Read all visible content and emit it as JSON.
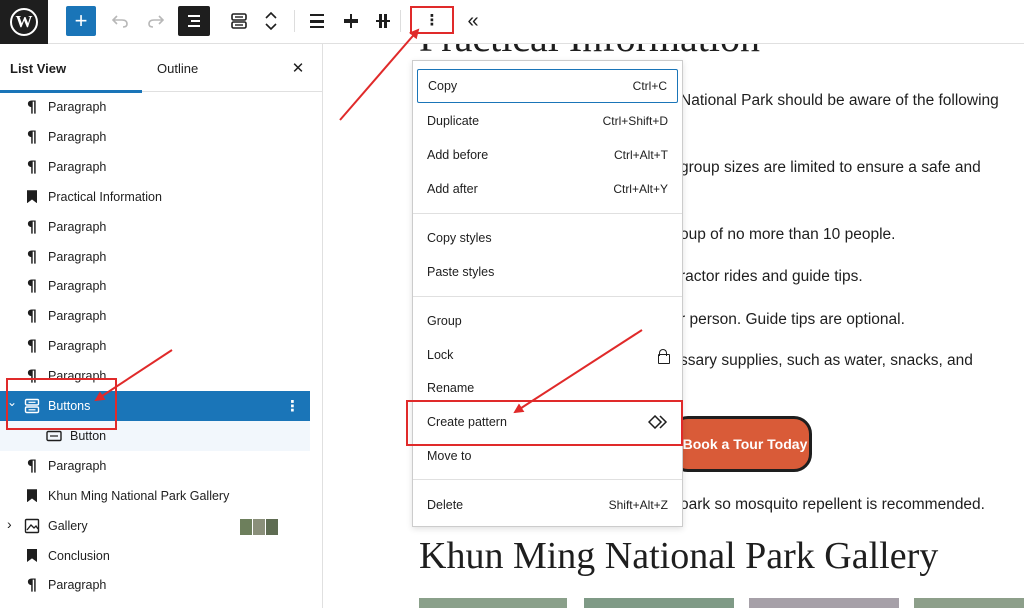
{
  "toolbar": {
    "logo_glyph": "W",
    "add_glyph": "+",
    "collapse_glyph": "«",
    "options_glyph": "⋮"
  },
  "sidebar": {
    "tabs": [
      {
        "label": "List View"
      },
      {
        "label": "Outline"
      }
    ],
    "close_glyph": "✕",
    "items": [
      {
        "label": "Paragraph",
        "icon": "paragraph-icon"
      },
      {
        "label": "Paragraph",
        "icon": "paragraph-icon"
      },
      {
        "label": "Paragraph",
        "icon": "paragraph-icon"
      },
      {
        "label": "Practical Information",
        "icon": "heading-bookmark-icon"
      },
      {
        "label": "Paragraph",
        "icon": "paragraph-icon"
      },
      {
        "label": "Paragraph",
        "icon": "paragraph-icon"
      },
      {
        "label": "Paragraph",
        "icon": "paragraph-icon"
      },
      {
        "label": "Paragraph",
        "icon": "paragraph-icon"
      },
      {
        "label": "Paragraph",
        "icon": "paragraph-icon"
      },
      {
        "label": "Paragraph",
        "icon": "paragraph-icon"
      },
      {
        "label": "Buttons",
        "icon": "buttons-icon",
        "selected": true
      },
      {
        "label": "Button",
        "icon": "button-icon",
        "child": true
      },
      {
        "label": "Paragraph",
        "icon": "paragraph-icon"
      },
      {
        "label": "Khun Ming National Park Gallery",
        "icon": "heading-bookmark-icon"
      },
      {
        "label": "Gallery",
        "icon": "gallery-icon"
      },
      {
        "label": "Conclusion",
        "icon": "heading-bookmark-icon"
      },
      {
        "label": "Paragraph",
        "icon": "paragraph-icon"
      }
    ]
  },
  "canvas": {
    "heading_top": "Practical Information",
    "lines": [
      "National Park should be aware of the following",
      "group sizes are limited to ensure a safe and",
      "oup of no more than 10 people.",
      "ractor rides and guide tips.",
      "r person. Guide tips are optional.",
      "ssary supplies, such as water, snacks, and",
      "oark so mosquito repellent is recommended."
    ],
    "tour_button": "Book a Tour Today",
    "gallery_heading": "Khun Ming National Park Gallery"
  },
  "menu": {
    "groups": [
      [
        {
          "label": "Copy",
          "shortcut": "Ctrl+C"
        },
        {
          "label": "Duplicate",
          "shortcut": "Ctrl+Shift+D"
        },
        {
          "label": "Add before",
          "shortcut": "Ctrl+Alt+T"
        },
        {
          "label": "Add after",
          "shortcut": "Ctrl+Alt+Y"
        }
      ],
      [
        {
          "label": "Copy styles",
          "shortcut": ""
        },
        {
          "label": "Paste styles",
          "shortcut": ""
        }
      ],
      [
        {
          "label": "Group",
          "shortcut": ""
        },
        {
          "label": "Lock",
          "shortcut": ""
        },
        {
          "label": "Rename",
          "shortcut": ""
        },
        {
          "label": "Create pattern",
          "shortcut": ""
        },
        {
          "label": "Move to",
          "shortcut": ""
        }
      ],
      [
        {
          "label": "Delete",
          "shortcut": "Shift+Alt+Z"
        }
      ]
    ]
  },
  "colors": {
    "accent": "#1a75b8",
    "annotation_red": "#e02a2a",
    "tour_button_bg": "#d95b38",
    "toolbar_dark": "#1e1e1e"
  }
}
